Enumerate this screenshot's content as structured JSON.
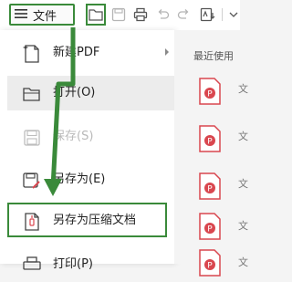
{
  "toolbar": {
    "file_label": "文件",
    "accent": "#3a8a3a"
  },
  "menu": {
    "items": [
      {
        "label": "新建PDF",
        "icon": "new-pdf-icon",
        "submenu": true
      },
      {
        "label": "打开(O)",
        "icon": "folder-open-icon",
        "hover": true
      },
      {
        "label": "保存(S)",
        "icon": "save-icon",
        "disabled": true
      },
      {
        "label": "另存为(E)",
        "icon": "save-as-icon"
      },
      {
        "label": "另存为压缩文档",
        "icon": "compress-doc-icon"
      },
      {
        "label": "打印(P)",
        "icon": "print-icon"
      }
    ]
  },
  "recent": {
    "title": "最近使用",
    "files": [
      {
        "suffix": "文"
      },
      {
        "suffix": "文"
      },
      {
        "suffix": "文"
      },
      {
        "suffix": "文"
      },
      {
        "suffix": "文"
      }
    ],
    "file_color": "#d9474f"
  }
}
